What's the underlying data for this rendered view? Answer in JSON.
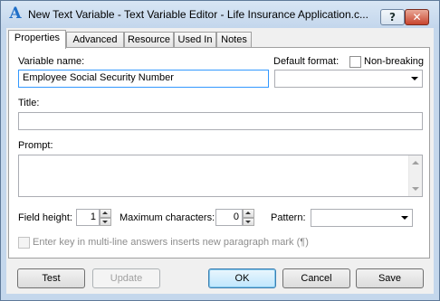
{
  "window": {
    "icon": "A",
    "title": "New Text Variable - Text Variable Editor - Life Insurance Application.c...",
    "help_label": "?",
    "close_label": "✕"
  },
  "tabs": [
    {
      "label": "Properties",
      "active": true
    },
    {
      "label": "Advanced",
      "active": false
    },
    {
      "label": "Resource",
      "active": false
    },
    {
      "label": "Used In",
      "active": false
    },
    {
      "label": "Notes",
      "active": false
    }
  ],
  "form": {
    "variable_name_label": "Variable name:",
    "variable_name_value": "Employee Social Security Number",
    "default_format_label": "Default format:",
    "default_format_value": "",
    "non_breaking_label": "Non-breaking",
    "title_label": "Title:",
    "title_value": "",
    "prompt_label": "Prompt:",
    "prompt_value": "",
    "field_height_label": "Field height:",
    "field_height_value": "1",
    "max_chars_label": "Maximum characters:",
    "max_chars_value": "0",
    "pattern_label": "Pattern:",
    "pattern_value": "",
    "enter_key_label": "Enter key in multi-line answers inserts new paragraph mark (¶)"
  },
  "buttons": {
    "test": "Test",
    "update": "Update",
    "ok": "OK",
    "cancel": "Cancel",
    "save": "Save"
  }
}
